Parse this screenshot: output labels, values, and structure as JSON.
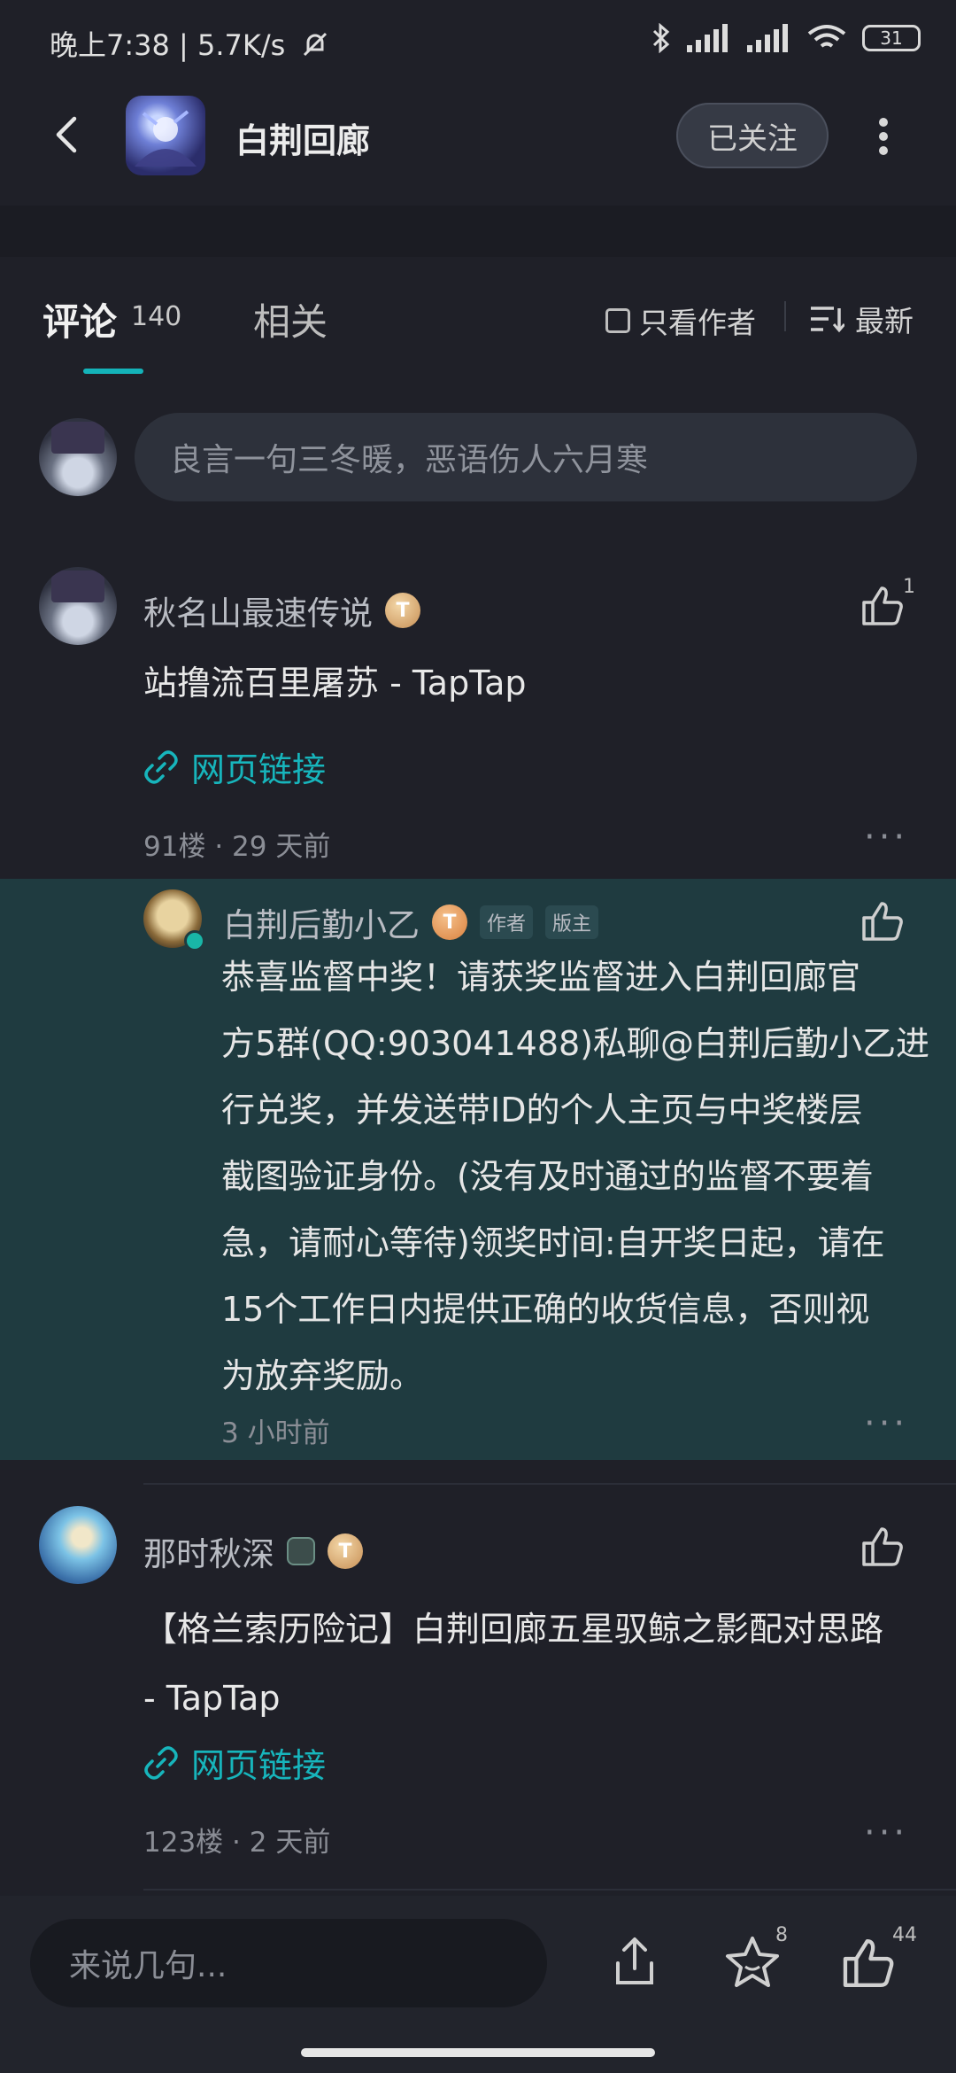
{
  "status_bar": {
    "left_text": "晚上7:38 | 5.7K/s",
    "battery": "31"
  },
  "header": {
    "title": "白荆回廊",
    "follow_label": "已关注"
  },
  "tabs": {
    "comments_label": "评论",
    "comments_count": "140",
    "related_label": "相关",
    "author_only_label": "只看作者",
    "sort_label": "最新"
  },
  "composer": {
    "placeholder": "良言一句三冬暖，恶语伤人六月寒"
  },
  "comments": [
    {
      "username": "秋名山最速传说",
      "badge": "T",
      "like_count": "1",
      "text": "站撸流百里屠苏 - TapTap",
      "link_label": "网页链接",
      "floor": "91楼",
      "time": "29 天前"
    },
    {
      "username": "那时秋深",
      "badge": "T",
      "text_line1": "【格兰索历险记】白荆回廊五星驭鲸之影配对思路",
      "text_line2": "- TapTap",
      "link_label": "网页链接",
      "floor": "123楼",
      "time": "2 天前"
    }
  ],
  "reply": {
    "username": "白荆后勤小乙",
    "badge": "T",
    "tag_author": "作者",
    "tag_admin": "版主",
    "lines": [
      "恭喜监督中奖！请获奖监督进入白荆回廊官",
      "方5群(QQ:903041488)私聊@白荆后勤小乙进",
      "行兑奖，并发送带ID的个人主页与中奖楼层",
      "截图验证身份。(没有及时通过的监督不要着",
      "急，请耐心等待)领奖时间:自开奖日起，请在",
      "15个工作日内提供正确的收货信息，否则视",
      "为放弃奖励。"
    ],
    "time": "3 小时前"
  },
  "bottom_bar": {
    "placeholder": "来说几句...",
    "star_count": "8",
    "like_count": "44"
  },
  "colors": {
    "accent": "#14b3b9",
    "background": "#1f2028",
    "reply_highlight": "#1f3b40"
  }
}
